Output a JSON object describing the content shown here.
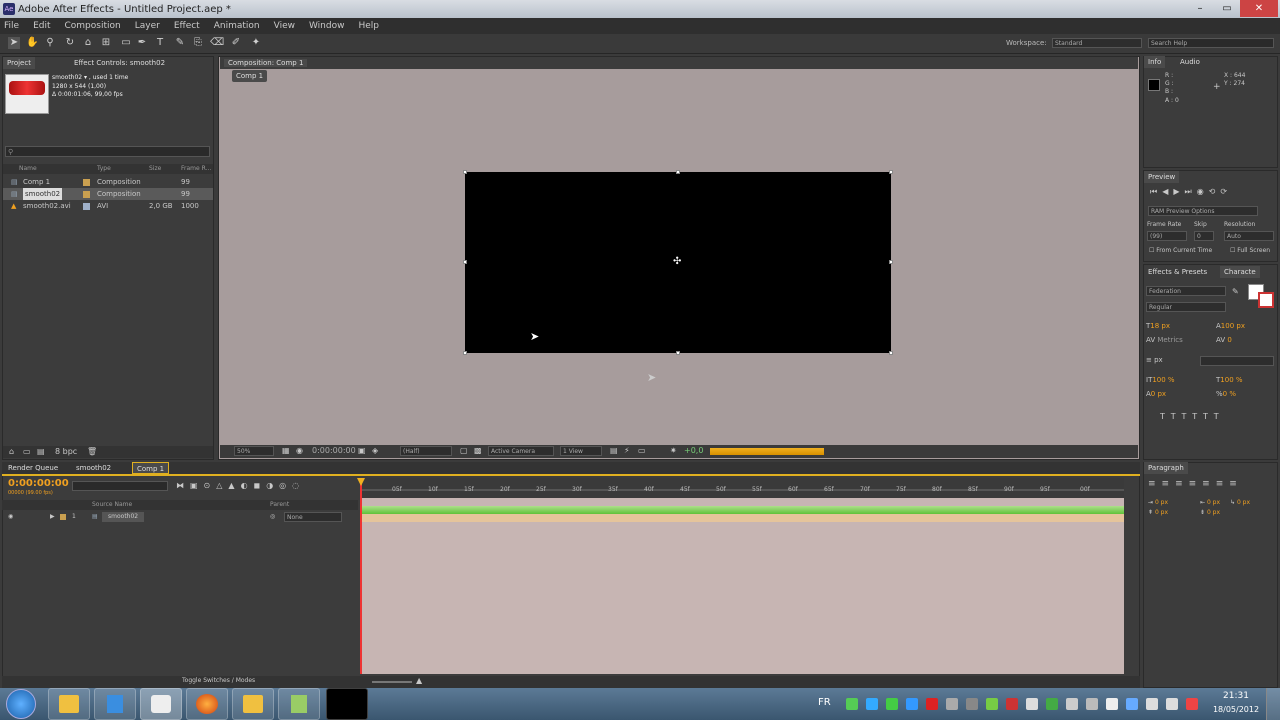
{
  "window": {
    "title": "Adobe After Effects - Untitled Project.aep *",
    "app_icon": "Ae",
    "min": "–",
    "max": "▭",
    "close": "✕"
  },
  "menu": [
    "File",
    "Edit",
    "Composition",
    "Layer",
    "Effect",
    "Animation",
    "View",
    "Window",
    "Help"
  ],
  "toolbar": {
    "workspace_label": "Workspace:",
    "workspace_value": "Standard",
    "search_placeholder": "Search Help"
  },
  "project": {
    "tab_project": "Project",
    "tab_effect_controls": "Effect Controls: smooth02",
    "preview_name": "smooth02 ▾ , used 1 time",
    "preview_dims": "1280 x 544 (1,00)",
    "preview_duration": "Δ 0:00:01:06, 99,00 fps",
    "columns": [
      "Name",
      "Type",
      "Size",
      "Frame R..."
    ],
    "items": [
      {
        "name": "Comp 1",
        "type": "Composition",
        "size": "",
        "rate": "99"
      },
      {
        "name": "smooth02",
        "type": "Composition",
        "size": "",
        "rate": "99"
      },
      {
        "name": "smooth02.avi",
        "type": "AVI",
        "size": "2,0 GB",
        "rate": "1000"
      }
    ],
    "bpc": "8 bpc"
  },
  "composition": {
    "tab": "Composition: Comp 1",
    "subtab": "Comp 1",
    "zoom": "50%",
    "timecode": "0:00:00:00",
    "resolution": "(Half)",
    "camera": "Active Camera",
    "views": "1 View",
    "exposure": "+0,0"
  },
  "info": {
    "tab_info": "Info",
    "tab_audio": "Audio",
    "r": "R :",
    "g": "G :",
    "b": "B :",
    "a": "A : 0",
    "x": "X : 644",
    "y": "Y : 274"
  },
  "preview": {
    "tab": "Preview",
    "ram_options": "RAM Preview Options",
    "frame_rate_label": "Frame Rate",
    "skip_label": "Skip",
    "resolution_label": "Resolution",
    "frame_rate": "(99)",
    "skip": "0",
    "resolution": "Auto",
    "from_current": "From Current Time",
    "full_screen": "Full Screen"
  },
  "character": {
    "tab_effects": "Effects & Presets",
    "tab_character": "Characte",
    "font": "Federation",
    "style": "Regular",
    "size": "18 px",
    "leading": "100 px",
    "kerning": "Metrics",
    "tracking": "0",
    "stroke": "px",
    "vscale": "100 %",
    "hscale": "100 %",
    "baseline": "0 px",
    "tsume": "0 %"
  },
  "paragraph": {
    "tab": "Paragraph",
    "indent1": "0 px",
    "indent2": "0 px",
    "indent3": "0 px",
    "space1": "0 px",
    "space2": "0 px"
  },
  "timeline": {
    "tab_render": "Render Queue",
    "tab_smooth": "smooth02",
    "tab_comp": "Comp 1",
    "timecode": "0:00:00:00",
    "timecode_sub": "00000 (99.00 fps)",
    "col_source": "Source Name",
    "col_parent": "Parent",
    "layer_num": "1",
    "layer_name": "smooth02",
    "layer_parent": "None",
    "toggle": "Toggle Switches / Modes",
    "ruler": [
      "0f",
      "05f",
      "10f",
      "15f",
      "20f",
      "25f",
      "30f",
      "35f",
      "40f",
      "45f",
      "50f",
      "55f",
      "60f",
      "65f",
      "70f",
      "75f",
      "80f",
      "85f",
      "90f",
      "95f",
      "00f"
    ]
  },
  "taskbar": {
    "lang": "FR",
    "time": "21:31",
    "date": "18/05/2012"
  },
  "colors": {
    "comp_bg": "#a79c9c",
    "timeline_bg": "#c7b5b3",
    "accent": "#f0a020"
  }
}
